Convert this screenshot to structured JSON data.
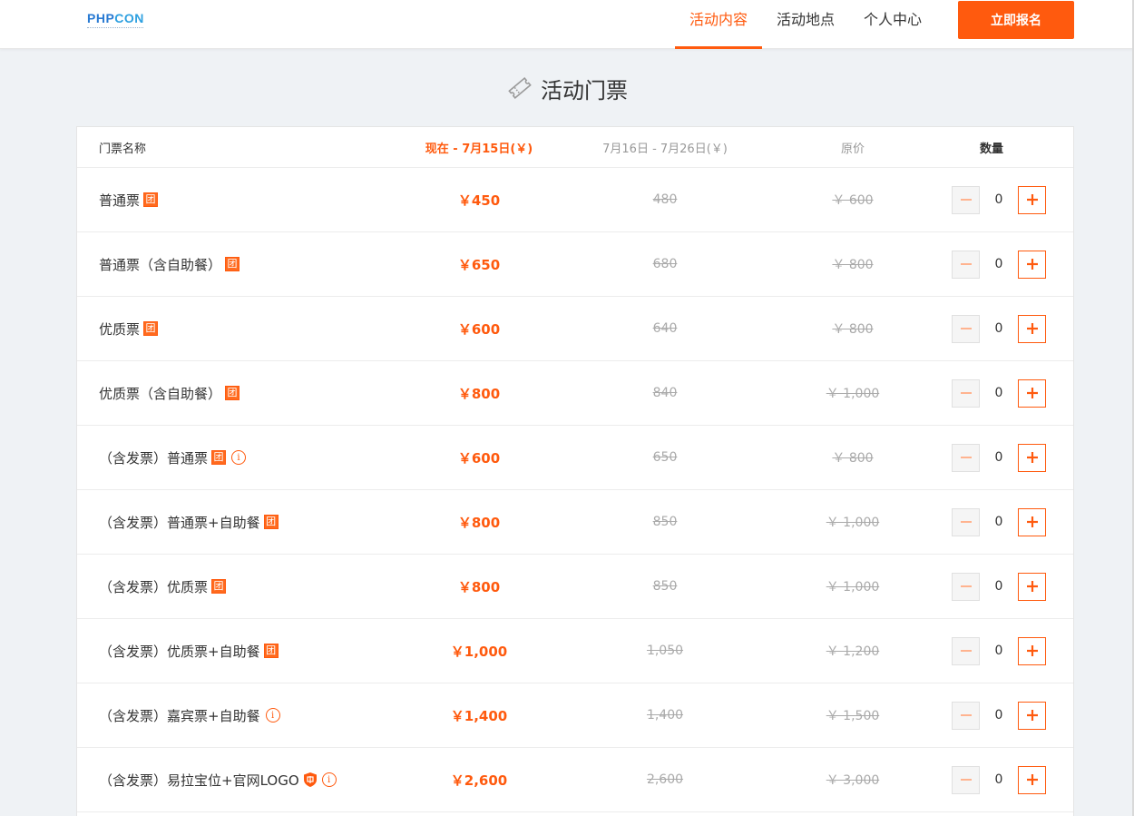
{
  "brand": {
    "logo_text_a": "PHP",
    "logo_text_b": "CON",
    "logo_icon": "phpcon-logo"
  },
  "nav": {
    "items": [
      {
        "label": "活动内容",
        "active": true
      },
      {
        "label": "活动地点",
        "active": false
      },
      {
        "label": "个人中心",
        "active": false
      }
    ],
    "register_label": "立即报名"
  },
  "section": {
    "title": "活动门票",
    "icon": "ticket-icon"
  },
  "table": {
    "headers": {
      "name": "门票名称",
      "now": "现在 - 7月15日(￥)",
      "early": "7月16日 - 7月26日(￥)",
      "original": "原价",
      "quantity": "数量"
    },
    "tag_group_text": "团",
    "tag_info_text": "i",
    "rows": [
      {
        "name": "普通票",
        "group": true,
        "info": false,
        "shield": false,
        "now": "￥450",
        "early": "480",
        "original": "￥ 600",
        "qty": "0"
      },
      {
        "name": "普通票（含自助餐）",
        "group": true,
        "info": false,
        "shield": false,
        "now": "￥650",
        "early": "680",
        "original": "￥ 800",
        "qty": "0"
      },
      {
        "name": "优质票",
        "group": true,
        "info": false,
        "shield": false,
        "now": "￥600",
        "early": "640",
        "original": "￥ 800",
        "qty": "0"
      },
      {
        "name": "优质票（含自助餐）",
        "group": true,
        "info": false,
        "shield": false,
        "now": "￥800",
        "early": "840",
        "original": "￥ 1,000",
        "qty": "0"
      },
      {
        "name": "（含发票）普通票",
        "group": true,
        "info": true,
        "shield": false,
        "now": "￥600",
        "early": "650",
        "original": "￥ 800",
        "qty": "0"
      },
      {
        "name": "（含发票）普通票+自助餐",
        "group": true,
        "info": false,
        "shield": false,
        "now": "￥800",
        "early": "850",
        "original": "￥ 1,000",
        "qty": "0"
      },
      {
        "name": "（含发票）优质票",
        "group": true,
        "info": false,
        "shield": false,
        "now": "￥800",
        "early": "850",
        "original": "￥ 1,000",
        "qty": "0"
      },
      {
        "name": "（含发票）优质票+自助餐",
        "group": true,
        "info": false,
        "shield": false,
        "now": "￥1,000",
        "early": "1,050",
        "original": "￥ 1,200",
        "qty": "0"
      },
      {
        "name": "（含发票）嘉宾票+自助餐",
        "group": false,
        "info": true,
        "shield": false,
        "now": "￥1,400",
        "early": "1,400",
        "original": "￥ 1,500",
        "qty": "0"
      },
      {
        "name": "（含发票）易拉宝位+官网LOGO",
        "group": false,
        "info": true,
        "shield": true,
        "now": "￥2,600",
        "early": "2,600",
        "original": "￥ 3,000",
        "qty": "0"
      }
    ]
  },
  "colors": {
    "accent": "#ff5a0e",
    "background": "#eff2f5",
    "muted": "#aaaaaa"
  }
}
